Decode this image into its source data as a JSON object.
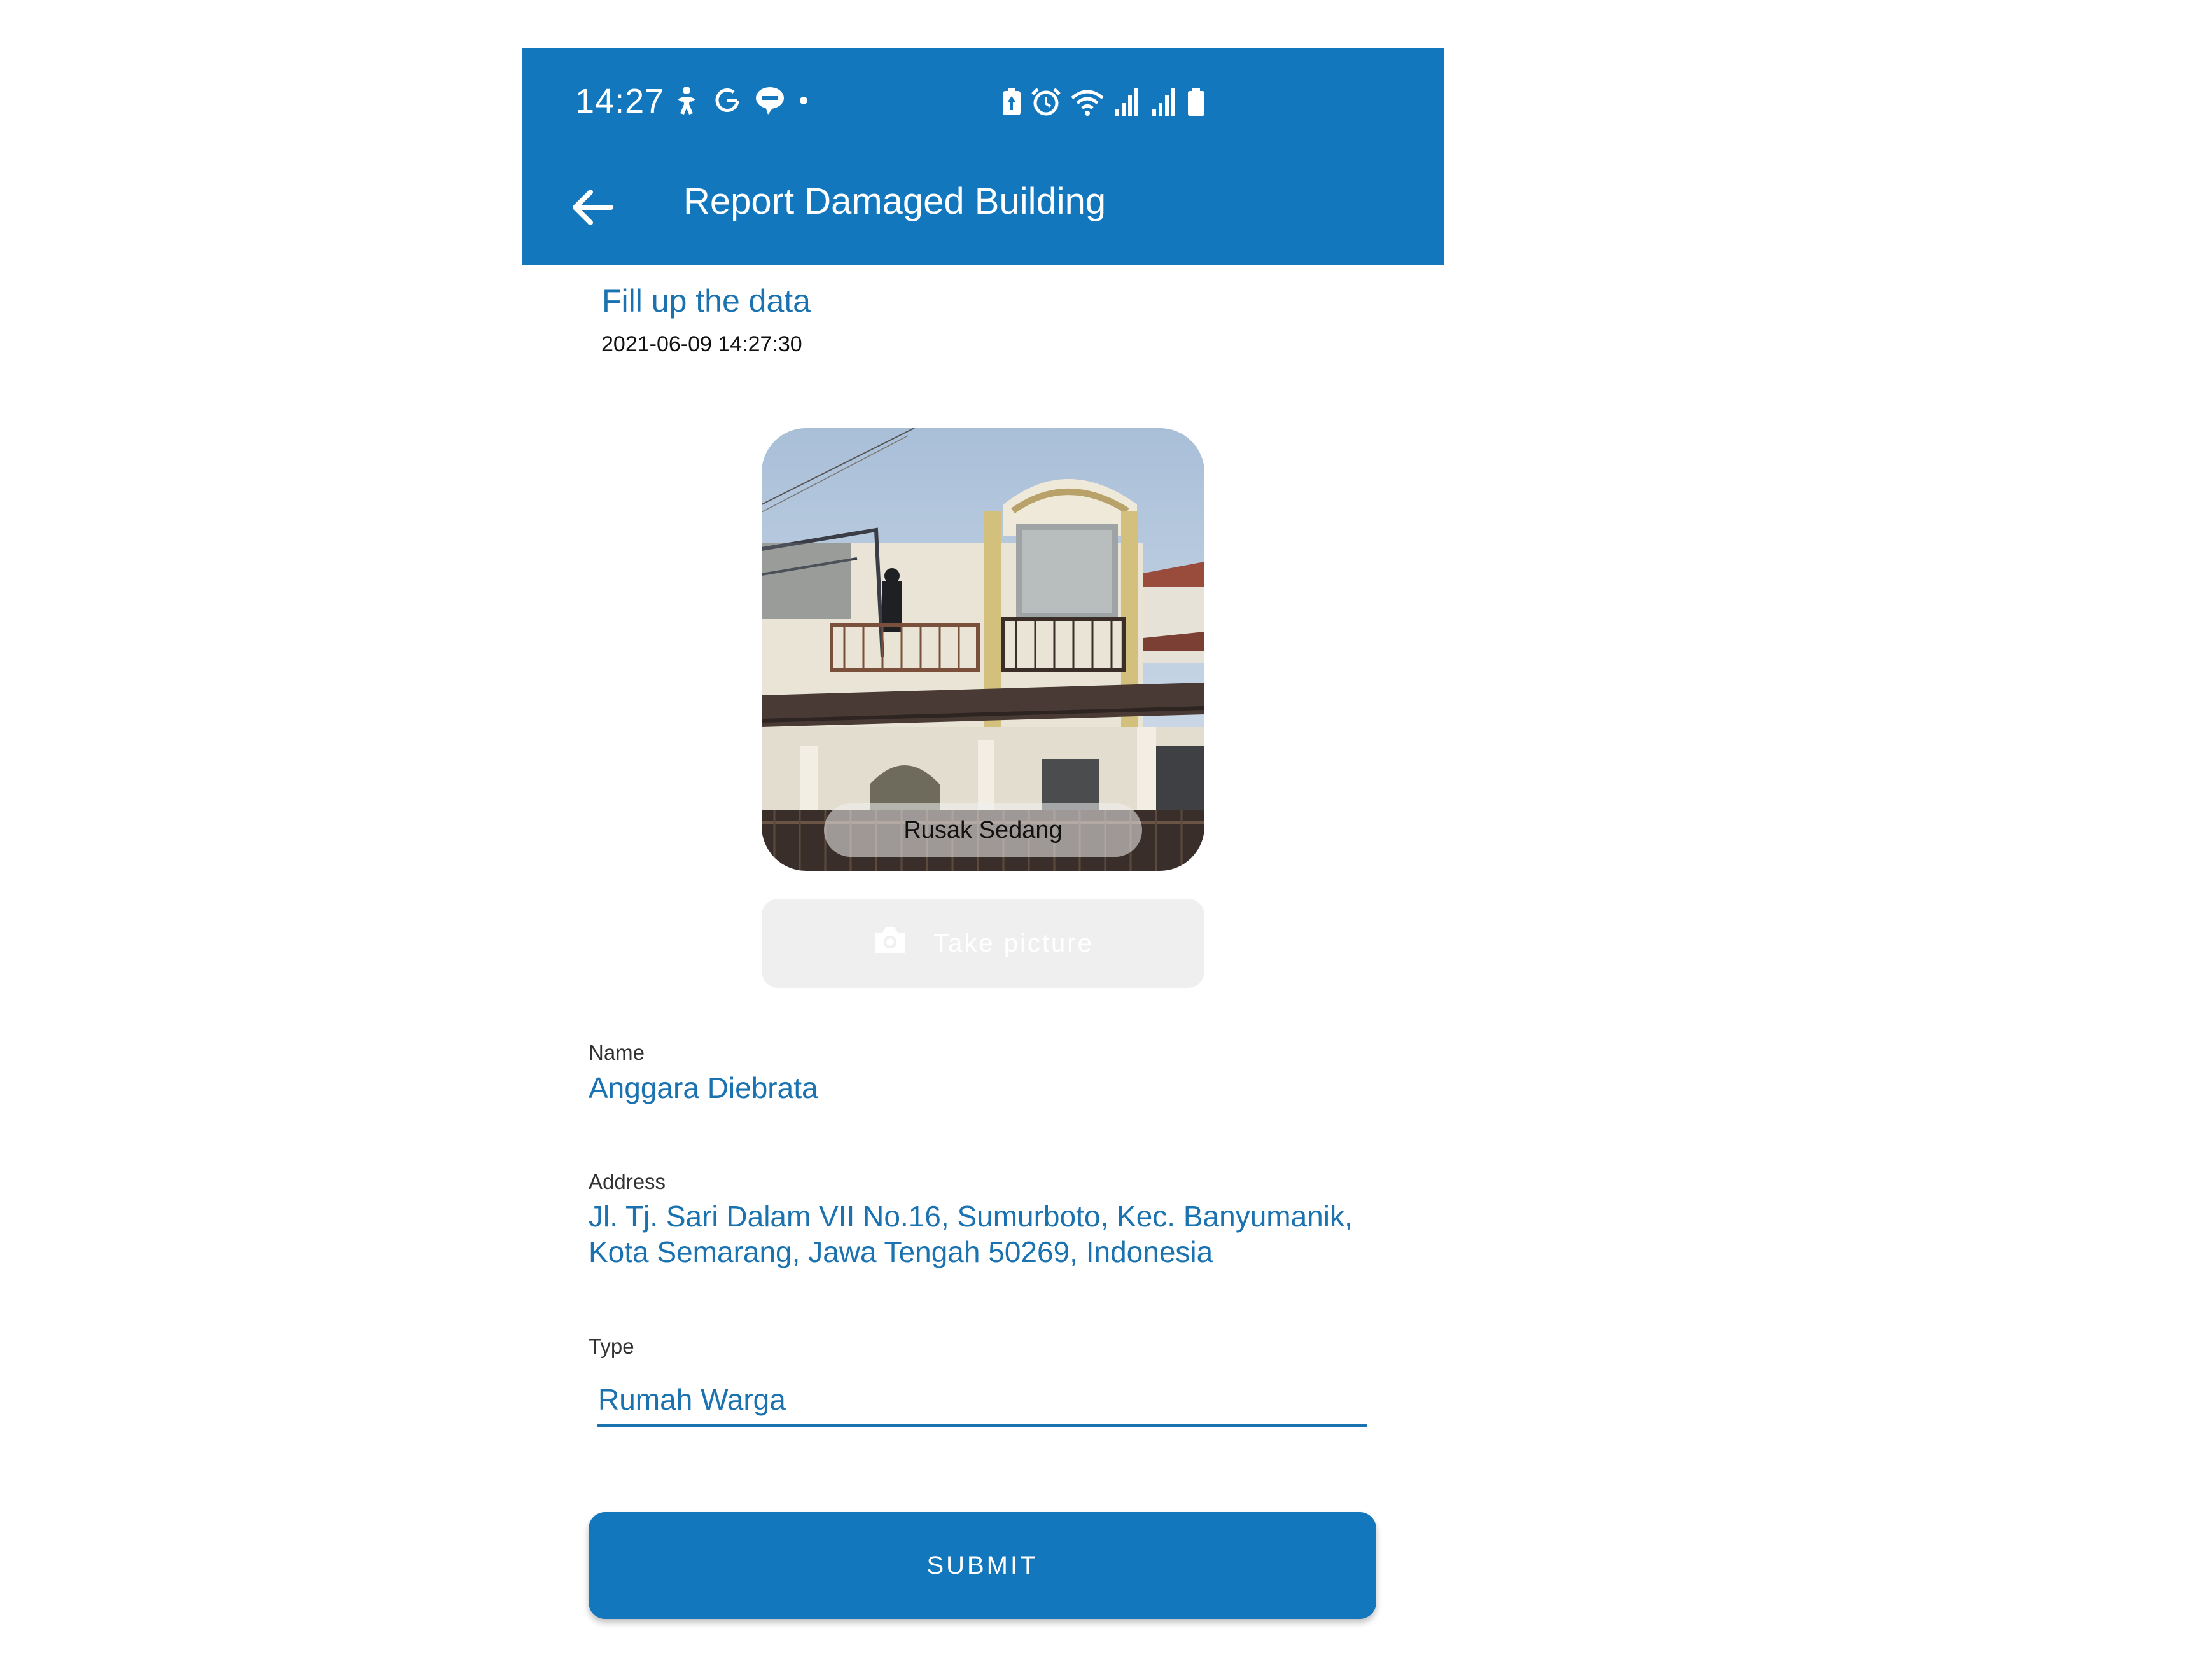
{
  "status_bar": {
    "time": "14:27",
    "left_icons": [
      "accessibility-icon",
      "google-icon",
      "line-chat-icon",
      "dot-icon"
    ],
    "right_icons": [
      "battery-saver-icon",
      "alarm-icon",
      "wifi-icon",
      "signal-icon",
      "signal-icon",
      "battery-icon"
    ]
  },
  "app_bar": {
    "title": "Report Damaged Building",
    "back_icon": "arrow-left-icon",
    "color": "#1377bd"
  },
  "form": {
    "subtitle": "Fill up the data",
    "timestamp": "2021-06-09 14:27:30",
    "photo": {
      "damage_label": "Rusak Sedang"
    },
    "take_picture": {
      "label": "Take picture",
      "icon": "camera-icon"
    },
    "name": {
      "label": "Name",
      "value": "Anggara Diebrata"
    },
    "address": {
      "label": "Address",
      "line1": "Jl. Tj. Sari Dalam VII No.16, Sumurboto, Kec. Banyumanik,",
      "line2": "Kota Semarang, Jawa Tengah 50269, Indonesia"
    },
    "type": {
      "label": "Type",
      "value": "Rumah Warga"
    },
    "submit_label": "SUBMIT"
  },
  "colors": {
    "primary": "#1377bd",
    "accent_text": "#1a72b0"
  }
}
